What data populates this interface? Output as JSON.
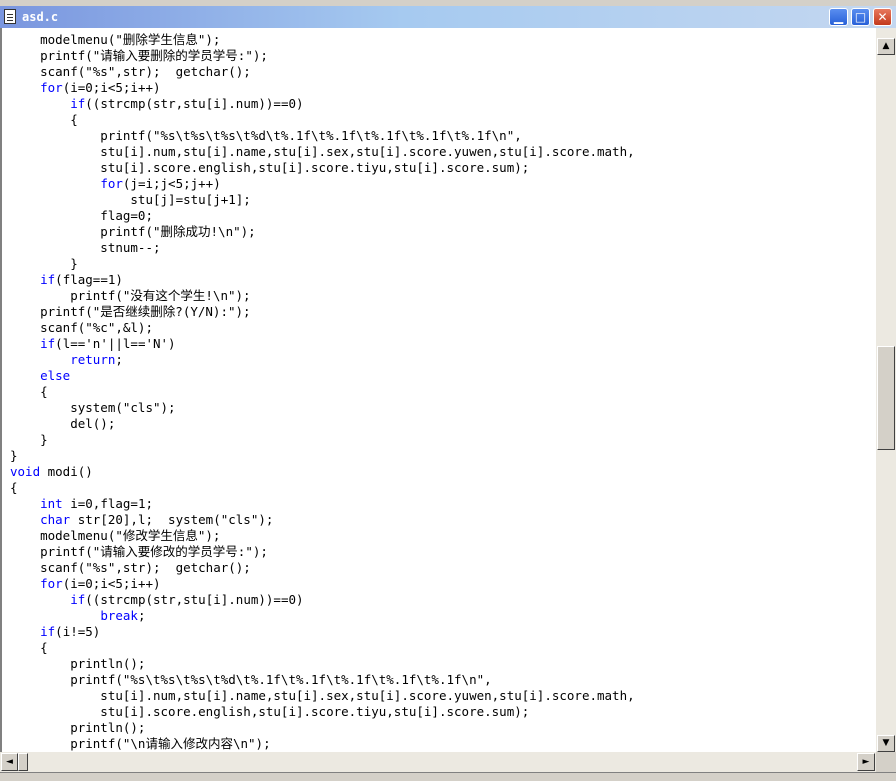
{
  "window": {
    "title": "asd.c",
    "buttons": {
      "minimize": "▁",
      "maximize": "□",
      "close": "✕"
    }
  },
  "colors": {
    "keyword": "#0000ff",
    "text": "#000000",
    "title_text": "#ffffff"
  },
  "editor": {
    "lines": [
      "    modelmenu(\"删除学生信息\");",
      "    printf(\"请输入要删除的学员学号:\");",
      "    scanf(\"%s\",str);  getchar();",
      "    for(i=0;i<5;i++)",
      "        if((strcmp(str,stu[i].num))==0)",
      "        {",
      "            printf(\"%s\\t%s\\t%s\\t%d\\t%.1f\\t%.1f\\t%.1f\\t%.1f\\t%.1f\\n\",",
      "            stu[i].num,stu[i].name,stu[i].sex,stu[i].score.yuwen,stu[i].score.math,",
      "            stu[i].score.english,stu[i].score.tiyu,stu[i].score.sum);",
      "            for(j=i;j<5;j++)",
      "                stu[j]=stu[j+1];",
      "            flag=0;",
      "            printf(\"删除成功!\\n\");",
      "            stnum--;",
      "        }",
      "    if(flag==1)",
      "        printf(\"没有这个学生!\\n\");",
      "    printf(\"是否继续删除?(Y/N):\");",
      "    scanf(\"%c\",&l);",
      "    if(l=='n'||l=='N')",
      "        return;",
      "    else",
      "    {",
      "        system(\"cls\");",
      "        del();",
      "    }",
      "}",
      "void modi()",
      "{",
      "    int i=0,flag=1;",
      "    char str[20],l;  system(\"cls\");",
      "    modelmenu(\"修改学生信息\");",
      "    printf(\"请输入要修改的学员学号:\");",
      "    scanf(\"%s\",str);  getchar();",
      "    for(i=0;i<5;i++)",
      "        if((strcmp(str,stu[i].num))==0)",
      "            break;",
      "    if(i!=5)",
      "    {",
      "        println();",
      "        printf(\"%s\\t%s\\t%s\\t%d\\t%.1f\\t%.1f\\t%.1f\\t%.1f\\t%.1f\\n\",",
      "            stu[i].num,stu[i].name,stu[i].sex,stu[i].score.yuwen,stu[i].score.math,",
      "            stu[i].score.english,stu[i].score.tiyu,stu[i].score.sum);",
      "        println();",
      "        printf(\"\\n请输入修改内容\\n\");"
    ]
  },
  "scrollbars": {
    "vertical": {
      "up_arrow": "▲",
      "down_arrow": "▼"
    },
    "horizontal": {
      "left_arrow": "◄",
      "right_arrow": "►"
    }
  }
}
